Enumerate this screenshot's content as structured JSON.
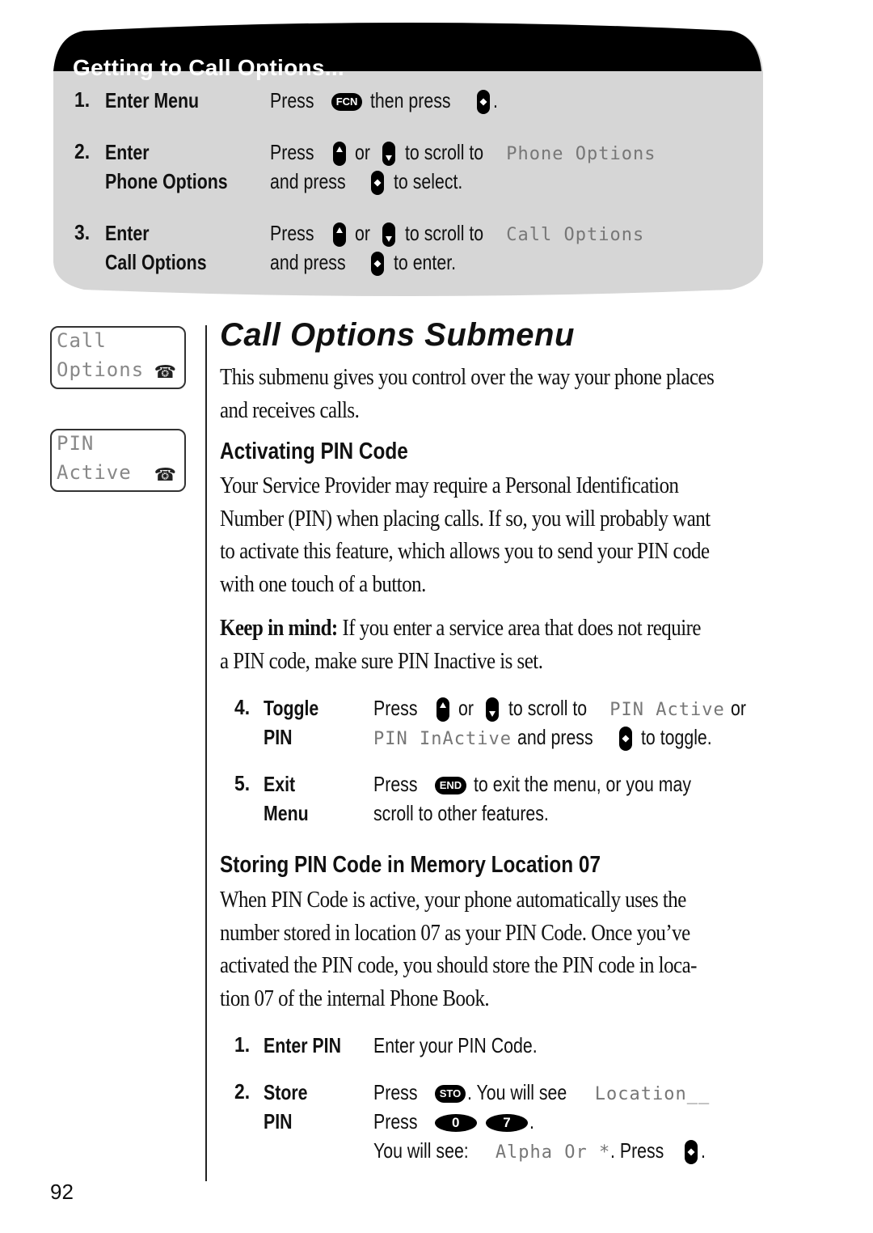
{
  "instruction_box": {
    "title": "Getting to Call Options...",
    "steps": [
      {
        "number": "1.",
        "label_lines": [
          "Enter Menu"
        ],
        "text": {
          "a": "Press",
          "key1": "FCN",
          "b": "then press",
          "c": "."
        }
      },
      {
        "number": "2.",
        "label_lines": [
          "Enter",
          "Phone Options"
        ],
        "line1": {
          "a": "Press",
          "b": "or",
          "c": "to scroll to",
          "lcd": "Phone Options"
        },
        "line2": {
          "a": "and press",
          "b": "to select."
        }
      },
      {
        "number": "3.",
        "label_lines": [
          "Enter",
          "Call Options"
        ],
        "line1": {
          "a": "Press",
          "b": "or",
          "c": "to scroll to",
          "lcd": "Call Options"
        },
        "line2": {
          "a": "and press",
          "b": "to enter."
        }
      }
    ]
  },
  "sidebar_displays": [
    {
      "line1": "Call",
      "line2": "Options",
      "icon": "telephone-icon"
    },
    {
      "line1": "PIN",
      "line2": "Active",
      "icon": "telephone-icon"
    }
  ],
  "main": {
    "title": "Call Options Submenu",
    "intro": [
      "This submenu gives you control over the way your phone places",
      "and receives calls."
    ],
    "section1": {
      "heading": "Activating PIN Code",
      "body": [
        "Your Service Provider may require a Personal Identification",
        "Number (PIN) when placing calls. If so, you will probably want",
        "to activate this feature, which allows you to send your PIN code",
        "with one touch of a button."
      ],
      "note_label": "Keep in mind:",
      "note_line1": " If you enter a service area that does not require",
      "note_line2": "a PIN code, make sure PIN Inactive is set.",
      "steps": [
        {
          "number": "4.",
          "label_lines": [
            "Toggle",
            "PIN"
          ],
          "line1": {
            "a": "Press",
            "b": "or",
            "c": "to scroll to",
            "lcd": "PIN Active",
            "d": "or"
          },
          "line2": {
            "lcd": "PIN InActive",
            "a": "and press",
            "b": "to toggle."
          }
        },
        {
          "number": "5.",
          "label_lines": [
            "Exit",
            "Menu"
          ],
          "line1": {
            "a": "Press",
            "key": "END",
            "b": "to exit the menu, or you may"
          },
          "line2": {
            "a": "scroll to other features."
          }
        }
      ]
    },
    "section2": {
      "heading": "Storing PIN Code in Memory Location 07",
      "body": [
        "When PIN Code is active, your phone automatically uses the",
        "number stored in location 07 as your PIN Code. Once you’ve",
        "activated the PIN code, you should store the PIN code in loca-",
        "tion 07 of the internal Phone Book."
      ],
      "steps": [
        {
          "number": "1.",
          "label_lines": [
            "Enter PIN"
          ],
          "line1": {
            "a": "Enter your PIN Code."
          }
        },
        {
          "number": "2.",
          "label_lines": [
            "Store",
            "PIN"
          ],
          "line1": {
            "a": "Press",
            "key": "STO",
            "b": ". You will see",
            "lcd": "Location__"
          },
          "line2": {
            "a": "Press",
            "key1": "0",
            "key2": "7",
            "b": "."
          },
          "line3": {
            "a": "You will see:",
            "lcd": "Alpha Or *",
            "b": ". Press",
            "c": "."
          }
        }
      ]
    }
  },
  "page_number": "92",
  "colors": {
    "box_gray": "#d6d6d6",
    "header_black": "#000000",
    "lcd_text": "#888888"
  }
}
